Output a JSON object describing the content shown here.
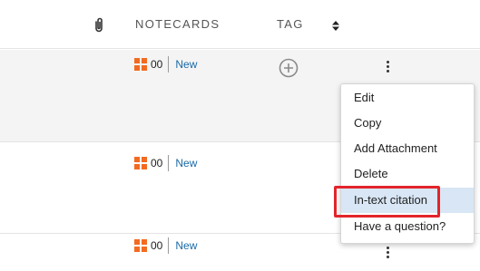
{
  "header": {
    "notecards_label": "NOTECARDS",
    "tag_label": "TAG"
  },
  "rows": [
    {
      "count": "00",
      "new_label": "New"
    },
    {
      "count": "00",
      "new_label": "New"
    },
    {
      "count": "00",
      "new_label": "New"
    }
  ],
  "context_menu": {
    "items": [
      {
        "label": "Edit"
      },
      {
        "label": "Copy"
      },
      {
        "label": "Add Attachment"
      },
      {
        "label": "Delete"
      },
      {
        "label": "In-text citation"
      },
      {
        "label": "Have a question?"
      }
    ],
    "highlighted_index": 4
  },
  "colors": {
    "accent_orange": "#f26b21",
    "link_blue": "#1a6aa8",
    "highlight_red": "#e3242b",
    "hover_blue": "#d8e6f5"
  },
  "icons": [
    "paperclip-icon",
    "sort-icon",
    "notecard-grid-icon",
    "add-tag-icon",
    "more-vert-icon"
  ]
}
